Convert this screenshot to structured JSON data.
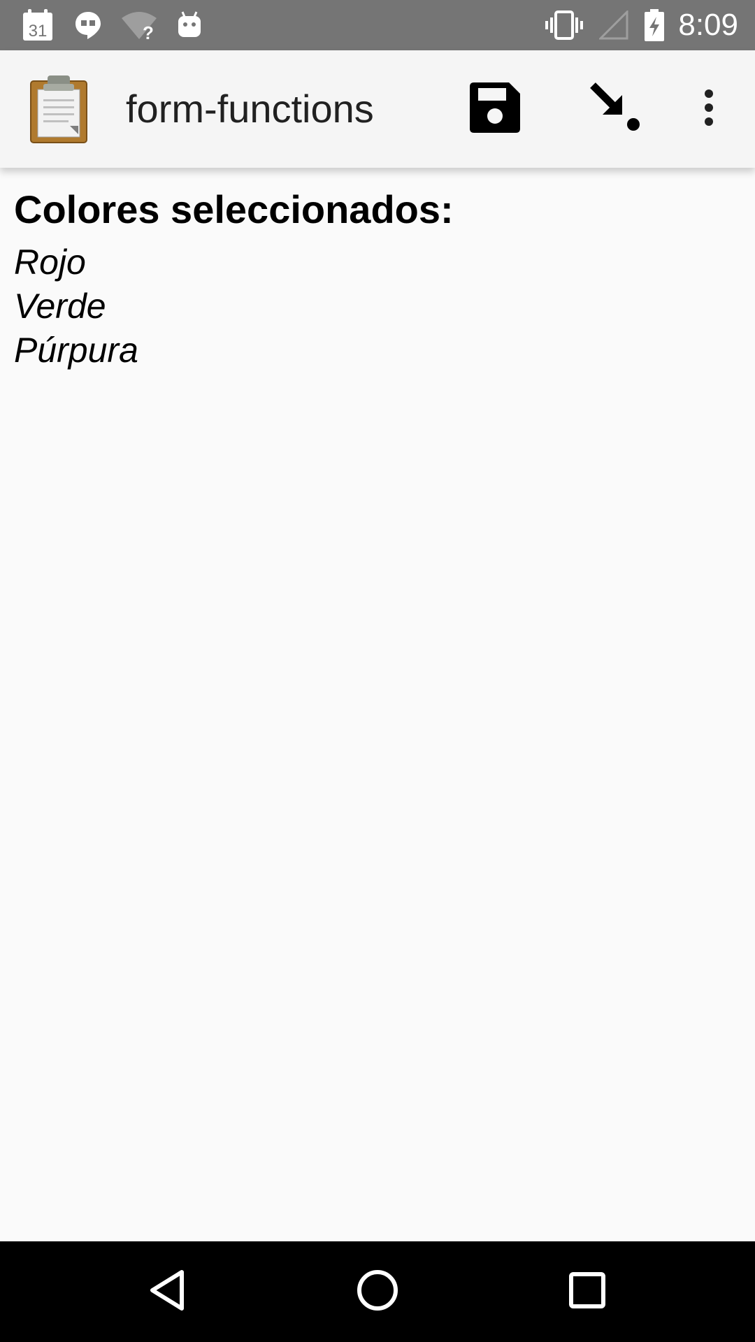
{
  "status_bar": {
    "time": "8:09",
    "calendar_day": "31",
    "left_icons": [
      "calendar-icon",
      "hangouts-icon",
      "wifi-unknown-icon",
      "android-debug-icon"
    ],
    "right_icons": [
      "vibrate-icon",
      "signal-empty-icon",
      "battery-charging-icon"
    ]
  },
  "app_bar": {
    "title": "form-functions",
    "logo_icon": "clipboard-icon",
    "actions": [
      "save-icon",
      "go-to-end-icon",
      "overflow-menu-icon"
    ]
  },
  "content": {
    "question_label": "Colores seleccionados:",
    "answers": [
      "Rojo",
      "Verde",
      "Púrpura"
    ]
  },
  "nav_bar": {
    "buttons": [
      "back-icon",
      "home-icon",
      "recents-icon"
    ]
  },
  "colors": {
    "status_bar": "#757575",
    "app_bar": "#f5f5f5",
    "background": "#fafafa",
    "nav_bar": "#000000",
    "text": "#000000"
  }
}
